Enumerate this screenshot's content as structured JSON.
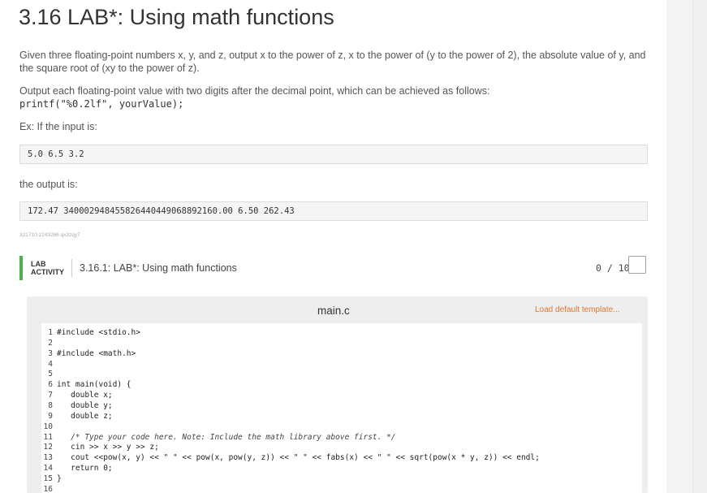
{
  "title": "3.16 LAB*: Using math functions",
  "description": {
    "paragraph1": "Given three floating-point numbers x, y, and z, output x to the power of z, x to the power of (y to the power of 2), the absolute value of y, and the square root of (xy to the power of z).",
    "paragraph2": "Output each floating-point value with two digits after the decimal point, which can be achieved as follows:",
    "code_example": "printf(\"%0.2lf\", yourValue);",
    "example_intro": "Ex: If the input is:",
    "input": "5.0 6.5 3.2",
    "output_intro": "the output is:",
    "output": "172.47 340002948455826440449068892160.00 6.50 262.43"
  },
  "small_id": "321710.2243266.qx3zqy7",
  "lab": {
    "tag_line1": "LAB",
    "tag_line2": "ACTIVITY",
    "title": "3.16.1: LAB*: Using math functions",
    "score": "0 / 10"
  },
  "editor": {
    "file_name": "main.c",
    "load_template": "Load default template...",
    "lines": [
      {
        "n": "1",
        "code": "#include <stdio.h>",
        "comment": false
      },
      {
        "n": "2",
        "code": "",
        "comment": false
      },
      {
        "n": "3",
        "code": "#include <math.h>",
        "comment": false
      },
      {
        "n": "4",
        "code": "",
        "comment": false
      },
      {
        "n": "5",
        "code": "",
        "comment": false
      },
      {
        "n": "6",
        "code": "int main(void) {",
        "comment": false
      },
      {
        "n": "7",
        "code": "   double x;",
        "comment": false
      },
      {
        "n": "8",
        "code": "   double y;",
        "comment": false
      },
      {
        "n": "9",
        "code": "   double z;",
        "comment": false
      },
      {
        "n": "10",
        "code": "",
        "comment": false
      },
      {
        "n": "11",
        "code": "   /* Type your code here. Note: Include the math library above first. */",
        "comment": true
      },
      {
        "n": "12",
        "code": "   cin >> x >> y >> z;",
        "comment": false
      },
      {
        "n": "13",
        "code": "   cout <<pow(x, y) << \" \" << pow(x, pow(y, z)) << \" \" << fabs(x) << \" \" << sqrt(pow(x * y, z)) << endl;",
        "comment": false
      },
      {
        "n": "14",
        "code": "   return 0;",
        "comment": false
      },
      {
        "n": "15",
        "code": "}",
        "comment": false
      },
      {
        "n": "16",
        "code": "",
        "comment": false
      }
    ]
  }
}
